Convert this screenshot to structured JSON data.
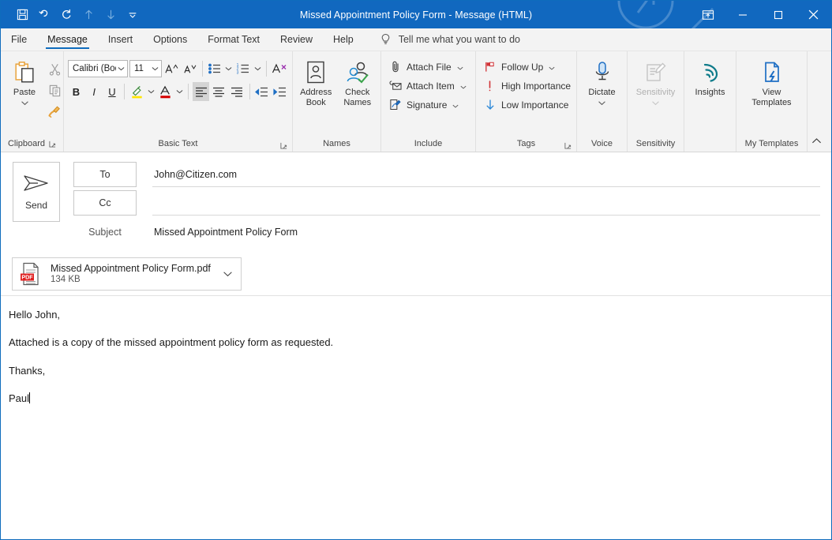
{
  "window": {
    "title": "Missed Appointment Policy Form  -  Message (HTML)",
    "accent_color": "#1168bf"
  },
  "quick_access": [
    {
      "name": "save",
      "label": "Save",
      "icon": "save-icon",
      "enabled": true
    },
    {
      "name": "undo",
      "label": "Undo",
      "icon": "undo-icon",
      "enabled": true
    },
    {
      "name": "redo",
      "label": "Redo",
      "icon": "redo-icon",
      "enabled": true
    },
    {
      "name": "previous",
      "label": "Previous Item",
      "icon": "arrow-up-icon",
      "enabled": false
    },
    {
      "name": "next",
      "label": "Next Item",
      "icon": "arrow-down-icon",
      "enabled": false
    },
    {
      "name": "customize",
      "label": "Customize Quick Access Toolbar",
      "icon": "chevron-down-icon",
      "enabled": true
    }
  ],
  "window_controls": {
    "ribbon_display": "Ribbon Display Options",
    "minimize": "–",
    "maximize": "☐",
    "close": "✕"
  },
  "tabs": [
    {
      "label": "File",
      "active": false
    },
    {
      "label": "Message",
      "active": true
    },
    {
      "label": "Insert",
      "active": false
    },
    {
      "label": "Options",
      "active": false
    },
    {
      "label": "Format Text",
      "active": false
    },
    {
      "label": "Review",
      "active": false
    },
    {
      "label": "Help",
      "active": false
    }
  ],
  "tell_me": {
    "placeholder": "Tell me what you want to do"
  },
  "ribbon": {
    "clipboard": {
      "group_label": "Clipboard",
      "paste_label": "Paste",
      "cut_label": "Cut",
      "copy_label": "Copy",
      "format_painter_label": "Format Painter"
    },
    "basic_text": {
      "group_label": "Basic Text",
      "font_name": "Calibri (Bod",
      "font_size": "11",
      "grow_font": "A",
      "shrink_font": "A",
      "bold": "B",
      "italic": "I",
      "underline": "U",
      "bullets_label": "Bullets",
      "numbering_label": "Numbering",
      "clear_formatting_label": "Clear All Formatting",
      "highlight_label": "Text Highlight Color",
      "font_color_label": "Font Color",
      "align_left_label": "Align Left",
      "align_center_label": "Center",
      "align_right_label": "Align Right",
      "decrease_indent_label": "Decrease Indent",
      "increase_indent_label": "Increase Indent"
    },
    "names": {
      "group_label": "Names",
      "address_book_line1": "Address",
      "address_book_line2": "Book",
      "check_names_line1": "Check",
      "check_names_line2": "Names"
    },
    "include": {
      "group_label": "Include",
      "attach_file": "Attach File",
      "attach_item": "Attach Item",
      "signature": "Signature"
    },
    "tags": {
      "group_label": "Tags",
      "follow_up": "Follow Up",
      "high_importance": "High Importance",
      "low_importance": "Low Importance"
    },
    "voice": {
      "group_label": "Voice",
      "dictate": "Dictate"
    },
    "sensitivity": {
      "group_label": "Sensitivity",
      "sensitivity": "Sensitivity",
      "disabled": true
    },
    "insights": {
      "group_label": "",
      "insights": "Insights"
    },
    "templates": {
      "group_label": "My Templates",
      "view_templates_line1": "View",
      "view_templates_line2": "Templates"
    },
    "collapse_label": "Collapse the Ribbon"
  },
  "compose": {
    "send_label": "Send",
    "to_label": "To",
    "to_value": "John@Citizen.com",
    "cc_label": "Cc",
    "cc_value": "",
    "subject_label": "Subject",
    "subject_value": "Missed Appointment Policy Form"
  },
  "attachment": {
    "file_name": "Missed Appointment Policy Form.pdf",
    "file_size": "134 KB",
    "type_badge": "PDF",
    "menu_label": "Attachment options"
  },
  "body": {
    "lines": [
      "Hello John,",
      "Attached is a copy of the missed appointment policy form as requested.",
      "Thanks,",
      "Paul"
    ]
  }
}
